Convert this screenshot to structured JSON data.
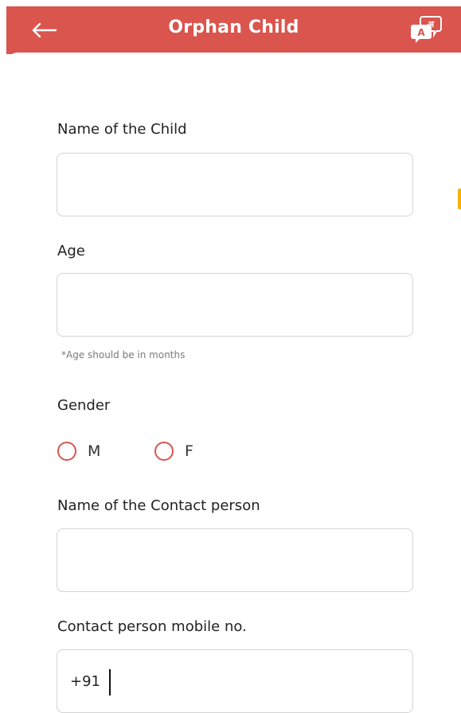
{
  "header": {
    "title": "Orphan Child",
    "background_color": "#d9554e",
    "back_icon": "arrow-left-icon",
    "language_icon": "translate-icon",
    "language_glyphs": [
      "A",
      "अ"
    ]
  },
  "form": {
    "child_name": {
      "label": "Name of the Child",
      "value": ""
    },
    "age": {
      "label": "Age",
      "value": "",
      "hint": "*Age should be in months"
    },
    "gender": {
      "label": "Gender",
      "options": [
        "M",
        "F"
      ],
      "selected": null
    },
    "contact_name": {
      "label": "Name of the Contact person",
      "value": ""
    },
    "contact_mobile": {
      "label": "Contact person mobile no.",
      "value": "+91"
    }
  },
  "accent_color": "#d9554e"
}
